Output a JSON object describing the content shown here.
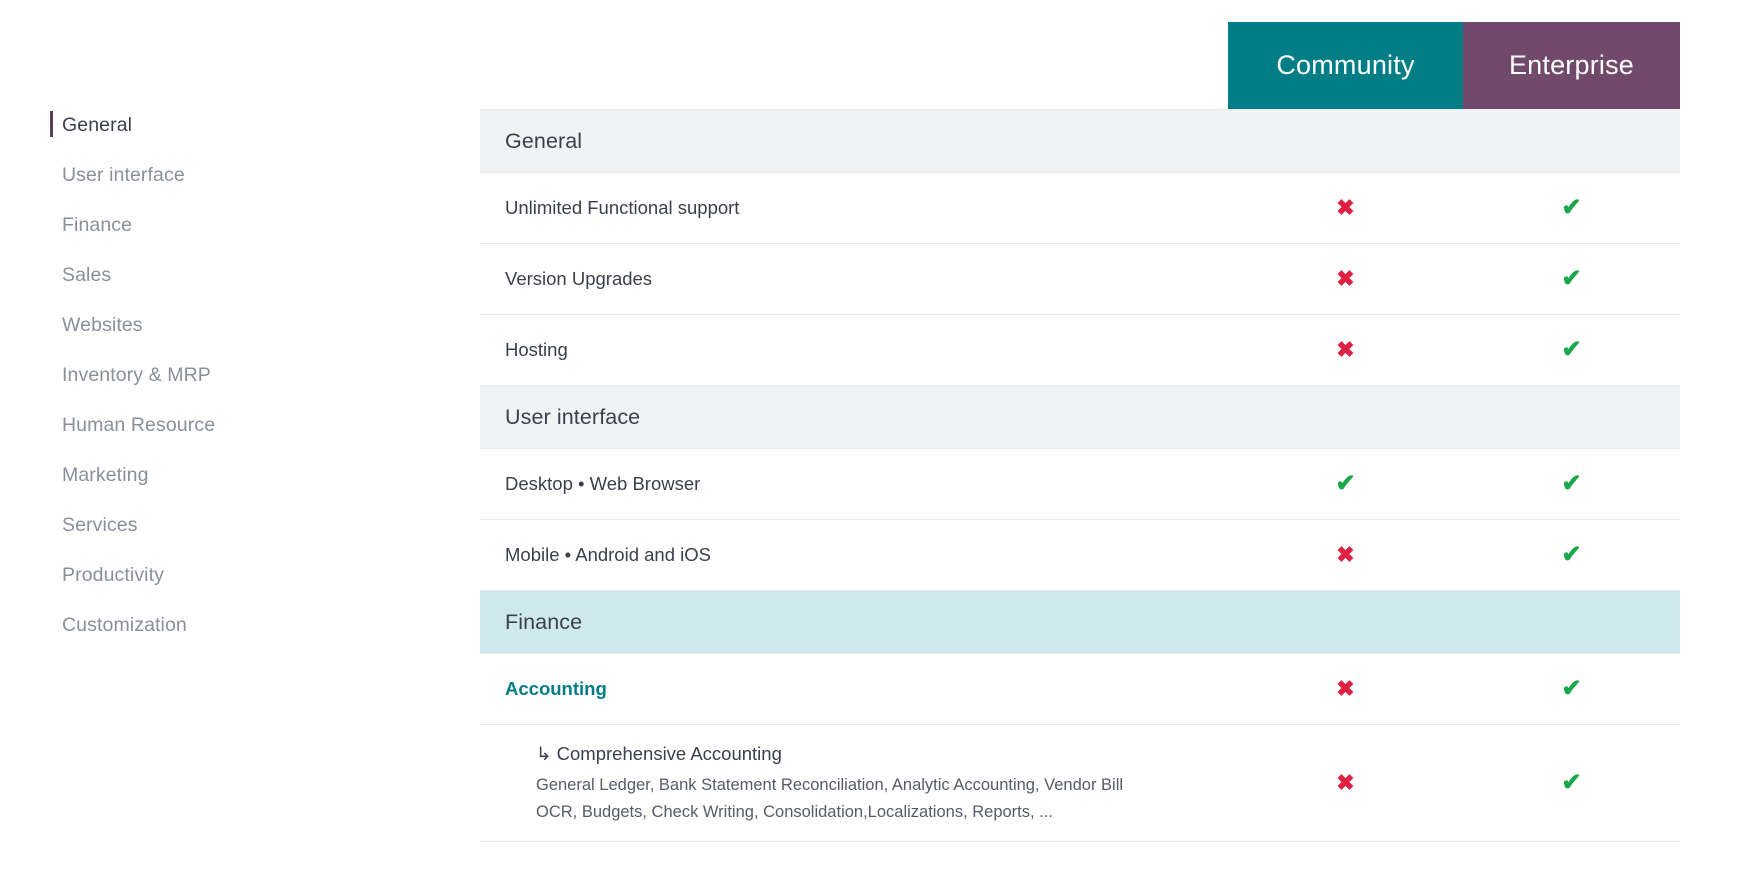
{
  "sidebar": {
    "items": [
      {
        "label": "General",
        "active": true
      },
      {
        "label": "User interface",
        "active": false
      },
      {
        "label": "Finance",
        "active": false
      },
      {
        "label": "Sales",
        "active": false
      },
      {
        "label": "Websites",
        "active": false
      },
      {
        "label": "Inventory & MRP",
        "active": false
      },
      {
        "label": "Human Resource",
        "active": false
      },
      {
        "label": "Marketing",
        "active": false
      },
      {
        "label": "Services",
        "active": false
      },
      {
        "label": "Productivity",
        "active": false
      },
      {
        "label": "Customization",
        "active": false
      }
    ]
  },
  "columns": {
    "community": "Community",
    "enterprise": "Enterprise",
    "community_color": "#017D86",
    "enterprise_color": "#714A6B"
  },
  "icons": {
    "yes": "✔",
    "no": "✖",
    "yes_color": "#1aa64b",
    "no_color": "#e02040",
    "sub_arrow": "↳"
  },
  "sections": [
    {
      "title": "General",
      "highlight": false,
      "rows": [
        {
          "label": "Unlimited Functional support",
          "community": "no",
          "enterprise": "yes"
        },
        {
          "label": "Version Upgrades",
          "community": "no",
          "enterprise": "yes"
        },
        {
          "label": "Hosting",
          "community": "no",
          "enterprise": "yes"
        }
      ]
    },
    {
      "title": "User interface",
      "highlight": false,
      "rows": [
        {
          "label": "Desktop • Web Browser",
          "community": "yes",
          "enterprise": "yes"
        },
        {
          "label": "Mobile • Android and iOS",
          "community": "no",
          "enterprise": "yes"
        }
      ]
    },
    {
      "title": "Finance",
      "highlight": true,
      "rows": [
        {
          "label": "Accounting",
          "link": true,
          "community": "no",
          "enterprise": "yes"
        },
        {
          "sub": true,
          "arrow": "↳",
          "label": "Comprehensive Accounting",
          "description": "General Ledger, Bank Statement Reconciliation, Analytic Accounting, Vendor Bill OCR, Budgets, Check Writing, Consolidation,Localizations, Reports, ...",
          "community": "no",
          "enterprise": "yes"
        }
      ]
    }
  ]
}
